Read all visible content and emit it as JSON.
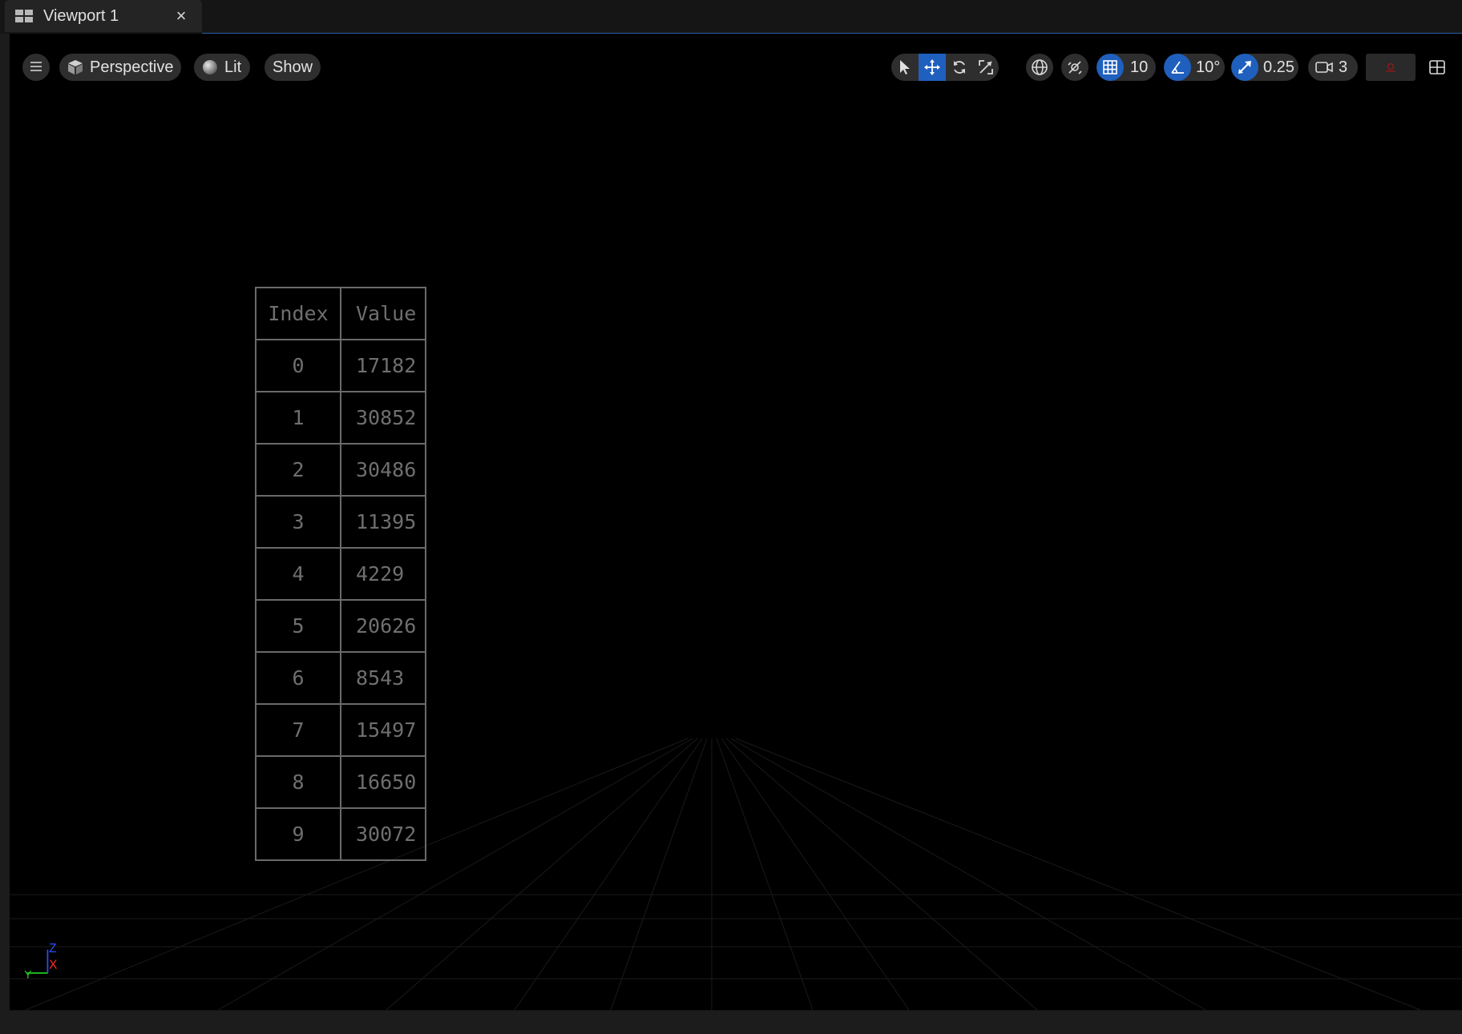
{
  "tab": {
    "title": "Viewport 1",
    "close_symbol": "×",
    "icon": "viewport-layout-icon"
  },
  "toolbar": {
    "menu_icon": "hamburger-menu-icon",
    "perspective_label": "Perspective",
    "lit_label": "Lit",
    "show_label": "Show",
    "grid_snap_value": "10",
    "rotation_snap_value": "10°",
    "scale_snap_value": "0.25",
    "camera_speed_value": "3",
    "accent_color": "#1f5fbd"
  },
  "table": {
    "headers": [
      "Index",
      "Value"
    ],
    "rows": [
      [
        "0",
        "17182"
      ],
      [
        "1",
        "30852"
      ],
      [
        "2",
        "30486"
      ],
      [
        "3",
        "11395"
      ],
      [
        "4",
        "4229"
      ],
      [
        "5",
        "20626"
      ],
      [
        "6",
        "8543"
      ],
      [
        "7",
        "15497"
      ],
      [
        "8",
        "16650"
      ],
      [
        "9",
        "30072"
      ]
    ]
  },
  "axis_gizmo": {
    "z_label": "Z",
    "x_label": "X",
    "y_label": "Y",
    "z_color": "#2a4fff",
    "x_color": "#ff2a2a",
    "y_color": "#22cc22"
  }
}
